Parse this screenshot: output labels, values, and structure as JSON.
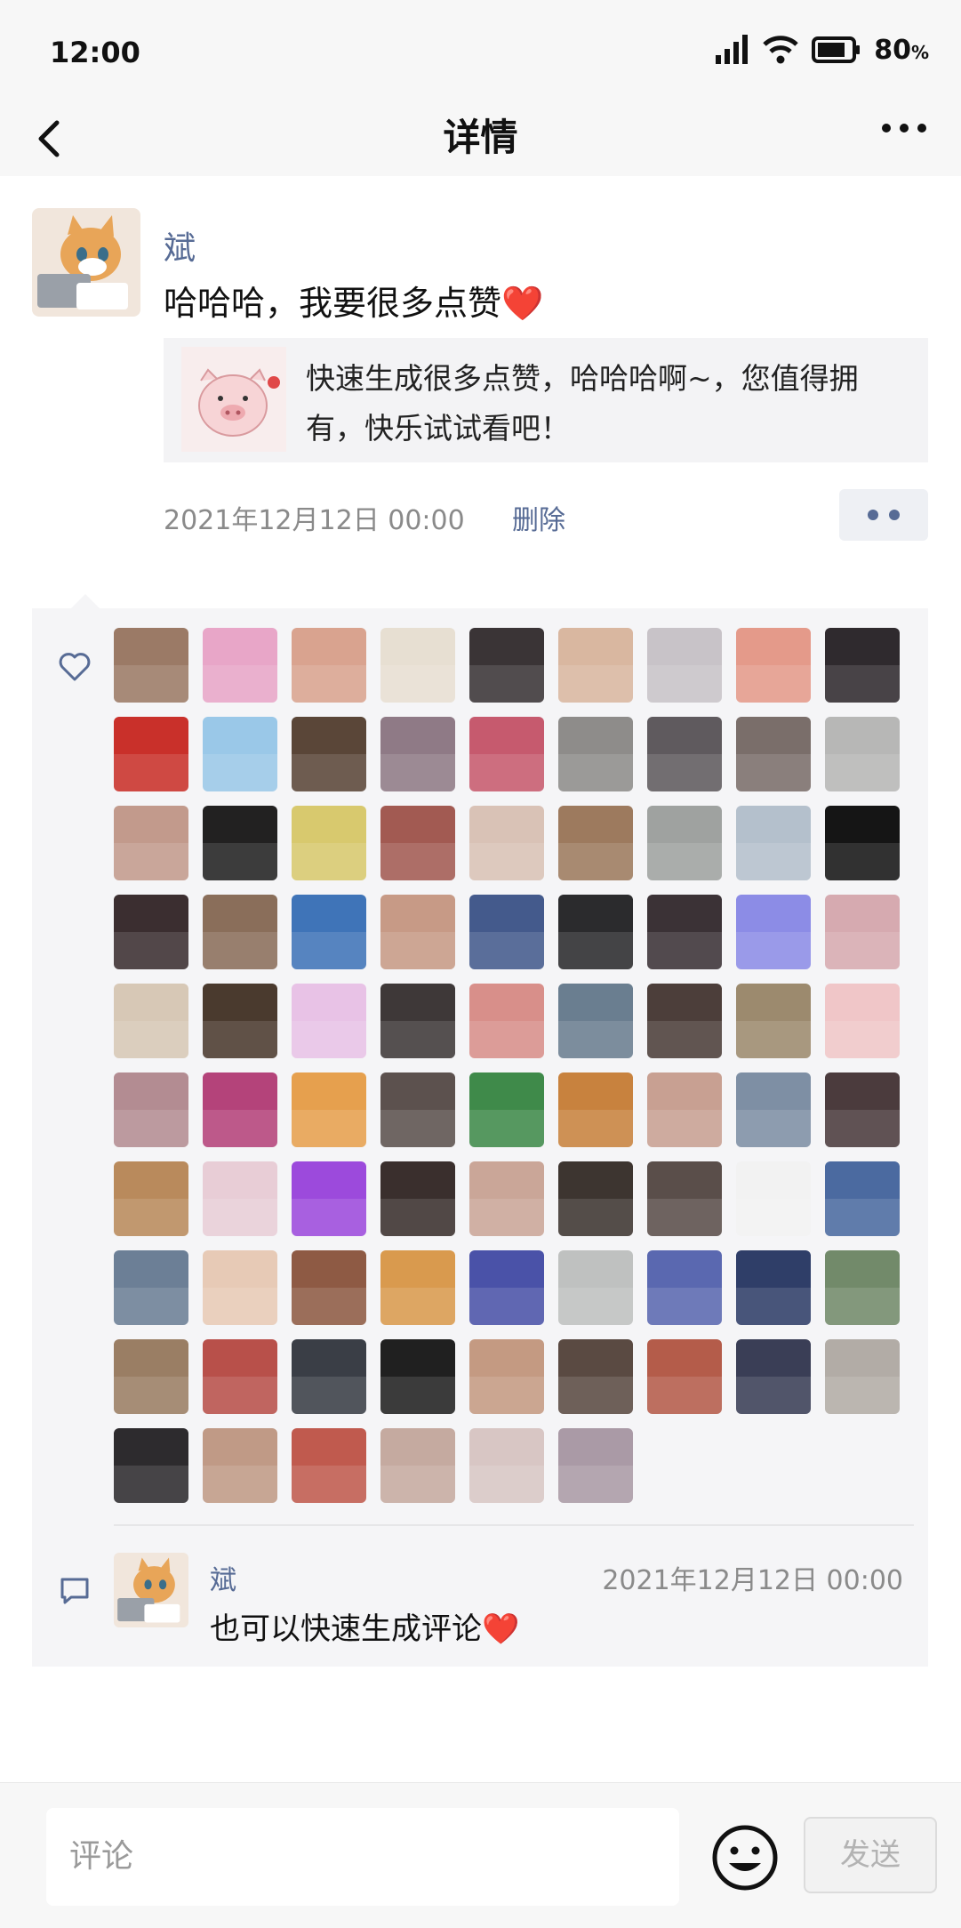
{
  "status_bar": {
    "time": "12:00",
    "battery": "80",
    "battery_unit": "%"
  },
  "nav": {
    "title": "详情",
    "back_icon": "chevron-left-icon",
    "more_icon": "more-dots-icon"
  },
  "post": {
    "author": "斌",
    "text": "哈哈哈，我要很多点赞",
    "heart": "❤️",
    "link_card": {
      "text": "快速生成很多点赞，哈哈哈啊~，您值得拥有，快乐试试看吧！"
    },
    "time": "2021年12月12日 00:00",
    "delete_label": "删除"
  },
  "likes": {
    "icon": "heart-outline-icon",
    "avatar_colors": [
      "#9b7a66",
      "#e8a6c8",
      "#d9a38f",
      "#e7dfd2",
      "#3a3436",
      "#d9b7a0",
      "#c8c3c8",
      "#e49a8a",
      "#2f2a2e",
      "#c9302a",
      "#9ac8e8",
      "#5a4638",
      "#8f7a86",
      "#c65a6e",
      "#8e8c8a",
      "#5f5a5e",
      "#7a6e6a",
      "#b7b7b6",
      "#c29a8c",
      "#222121",
      "#d8c96e",
      "#a25a52",
      "#d9c2b6",
      "#9d7a5e",
      "#9fa2a0",
      "#b4c0cc",
      "#151515",
      "#3b2e30",
      "#8a6e5a",
      "#3f74b8",
      "#c79a86",
      "#445a8c",
      "#2b2b2d",
      "#3b3236",
      "#8c8ce6",
      "#d6aab0",
      "#d7c8b6",
      "#4a3a2e",
      "#e8c2e6",
      "#3e3838",
      "#d88f8a",
      "#6a7e90",
      "#4c3e3a",
      "#9c8a6e",
      "#f0c6c8",
      "#b38c92",
      "#b4437a",
      "#e6a04e",
      "#5c514e",
      "#3f8a4a",
      "#c8823e",
      "#c8a092",
      "#7e8fa4",
      "#4b3b3d",
      "#b98a5c",
      "#e8cdd6",
      "#9c4adc",
      "#3a2f2d",
      "#caa698",
      "#3d3530",
      "#5a4e4a",
      "#f2f2f2",
      "#4b6aa0",
      "#6c7f96",
      "#e7cab6",
      "#8e5a44",
      "#d99a4e",
      "#4a52a8",
      "#bfc1c0",
      "#5a68b0",
      "#2f3e68",
      "#728a6a",
      "#9a7e64",
      "#b8504a",
      "#3a3e46",
      "#202020",
      "#c49a82",
      "#5a4a42",
      "#b45c4a",
      "#3a3e56",
      "#b2aca6",
      "#2d2b2e",
      "#c09a86",
      "#c05a4e",
      "#c5aaa0",
      "#d8c6c4",
      "#aa9aa6"
    ]
  },
  "comment": {
    "icon": "comment-bubble-icon",
    "author": "斌",
    "time": "2021年12月12日 00:00",
    "text": "也可以快速生成评论",
    "heart": "❤️"
  },
  "bottom": {
    "input_placeholder": "评论",
    "emoji_icon": "smile-emoji-icon",
    "send_label": "发送"
  },
  "colors": {
    "link_blue": "#576b95",
    "meta_gray": "#8a8a8a",
    "panel_bg": "#f5f5f7",
    "heart_red": "#e02828"
  }
}
